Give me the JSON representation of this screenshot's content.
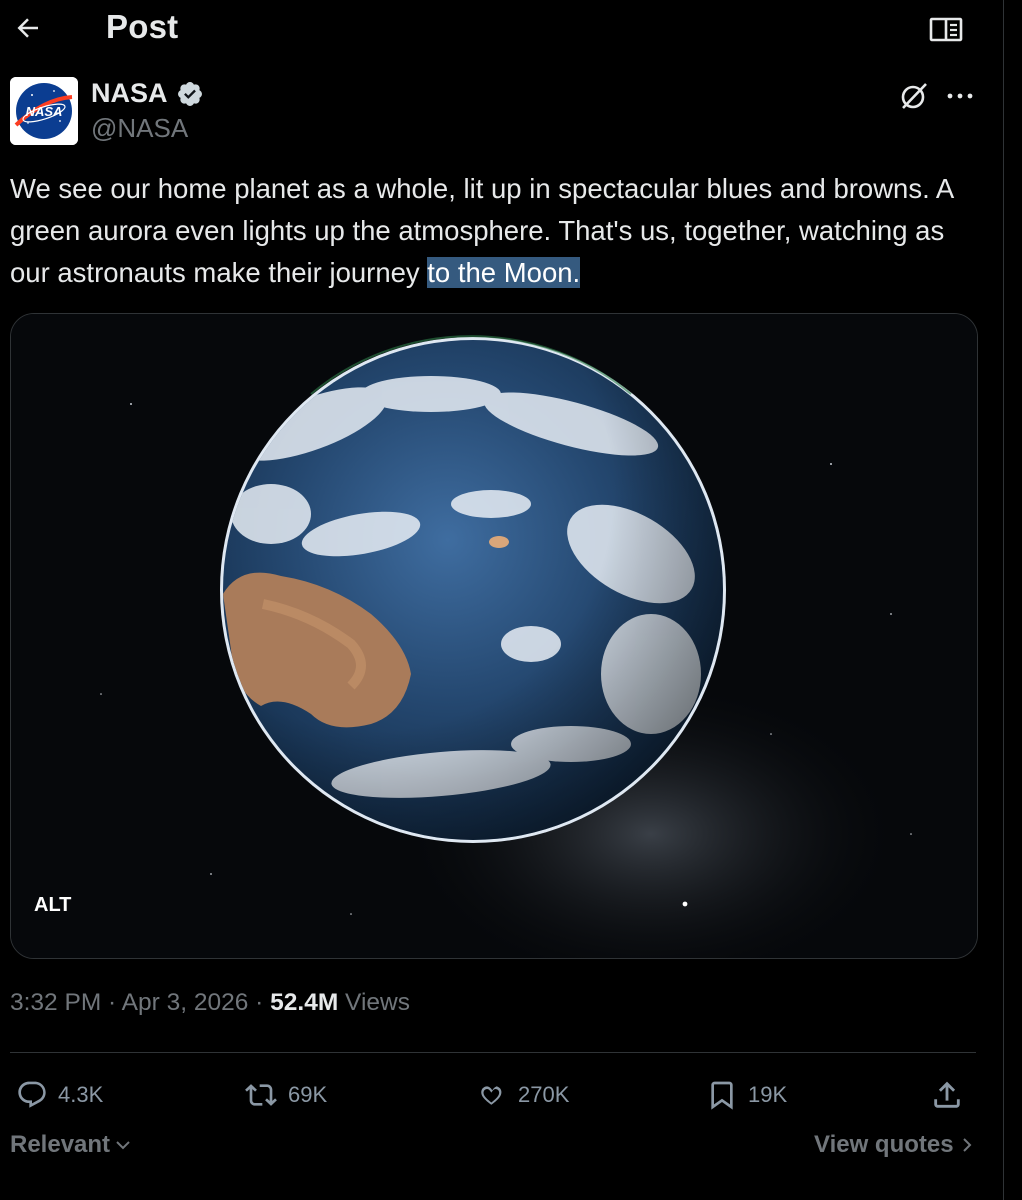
{
  "header": {
    "title": "Post"
  },
  "author": {
    "name": "NASA",
    "handle": "@NASA",
    "avatar_text": "NASA",
    "verified_color": "#ffffff"
  },
  "post": {
    "text_plain": "We see our home planet as a whole, lit up in spectacular blues and browns. A green aurora even lights up the atmosphere. That's us, together, watching as our astronauts make their journey ",
    "text_highlighted": "to the Moon."
  },
  "media": {
    "alt_label": "ALT"
  },
  "meta": {
    "time": "3:32 PM",
    "separator": " · ",
    "date": "Apr 3, 2026",
    "views_count": "52.4M",
    "views_label": " Views"
  },
  "actions": {
    "replies": "4.3K",
    "reposts": "69K",
    "likes": "270K",
    "bookmarks": "19K"
  },
  "footer": {
    "sort_label": "Relevant",
    "quotes_label": "View quotes"
  },
  "colors": {
    "background": "#000000",
    "text": "#e7e9ea",
    "muted": "#71767b",
    "highlight": "#355a7f"
  }
}
